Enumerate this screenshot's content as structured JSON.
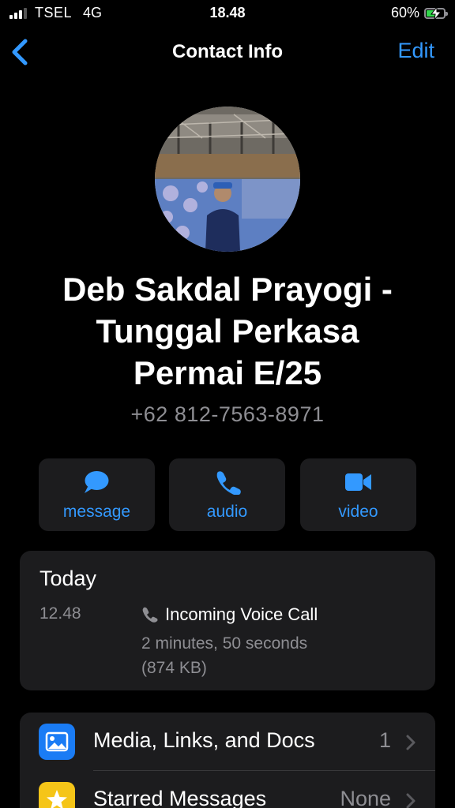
{
  "status_bar": {
    "carrier": "TSEL",
    "network": "4G",
    "time": "18.48",
    "battery": "60%"
  },
  "nav": {
    "title": "Contact Info",
    "edit_label": "Edit"
  },
  "contact": {
    "name_lines": [
      "Deb Sakdal Prayogi -",
      "Tunggal Perkasa",
      "Permai E/25"
    ],
    "phone": "+62 812-7563-8971"
  },
  "actions": [
    {
      "label": "message",
      "icon": "message-icon"
    },
    {
      "label": "audio",
      "icon": "phone-icon"
    },
    {
      "label": "video",
      "icon": "video-icon"
    }
  ],
  "call_log": {
    "day": "Today",
    "time": "12.48",
    "type": "Incoming Voice Call",
    "duration": "2 minutes, 50 seconds",
    "size": "(874 KB)"
  },
  "list": [
    {
      "label": "Media, Links, and Docs",
      "value": "1",
      "icon": "photo-icon",
      "color": "#1a7cf5"
    },
    {
      "label": "Starred Messages",
      "value": "None",
      "icon": "star-icon",
      "color": "#f5c518"
    }
  ],
  "colors": {
    "accent": "#3399ff",
    "background": "#000000",
    "card": "#1c1c1e"
  }
}
